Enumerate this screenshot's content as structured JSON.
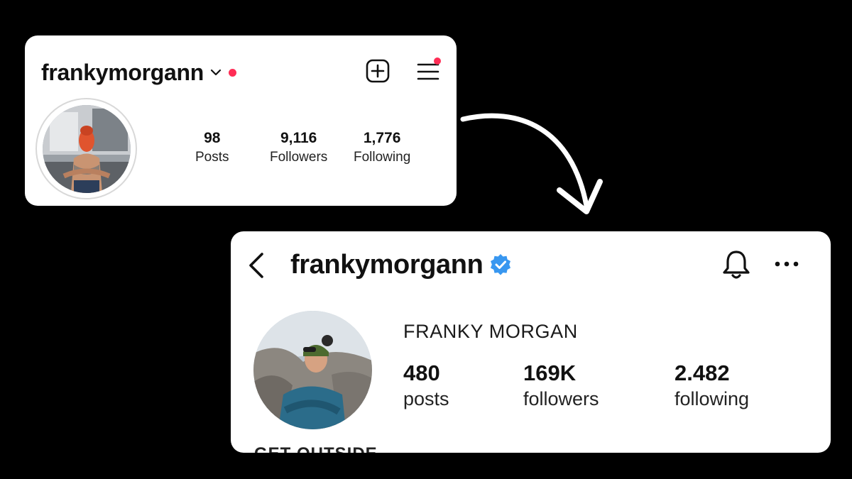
{
  "before_profile": {
    "username": "frankymorgann",
    "stats": [
      {
        "value": "98",
        "label": "Posts"
      },
      {
        "value": "9,116",
        "label": "Followers"
      },
      {
        "value": "1,776",
        "label": "Following"
      }
    ],
    "icons": [
      "chevron-down-icon",
      "notification-dot",
      "add-post-icon",
      "menu-icon"
    ],
    "notification_color": "#ff2d55"
  },
  "after_profile": {
    "username": "frankymorgann",
    "verified": true,
    "verified_color": "#3897f0",
    "full_name": "FRANKY MORGAN",
    "stats": [
      {
        "value": "480",
        "label": "posts"
      },
      {
        "value": "169K",
        "label": "followers"
      },
      {
        "value": "2.482",
        "label": "following"
      }
    ],
    "bio_partial": "GET OUTSIDE",
    "icons": [
      "back-arrow-icon",
      "verified-badge-icon",
      "bell-icon",
      "more-icon"
    ]
  },
  "arrow": {
    "color": "#ffffff"
  },
  "background_color": "#000000"
}
